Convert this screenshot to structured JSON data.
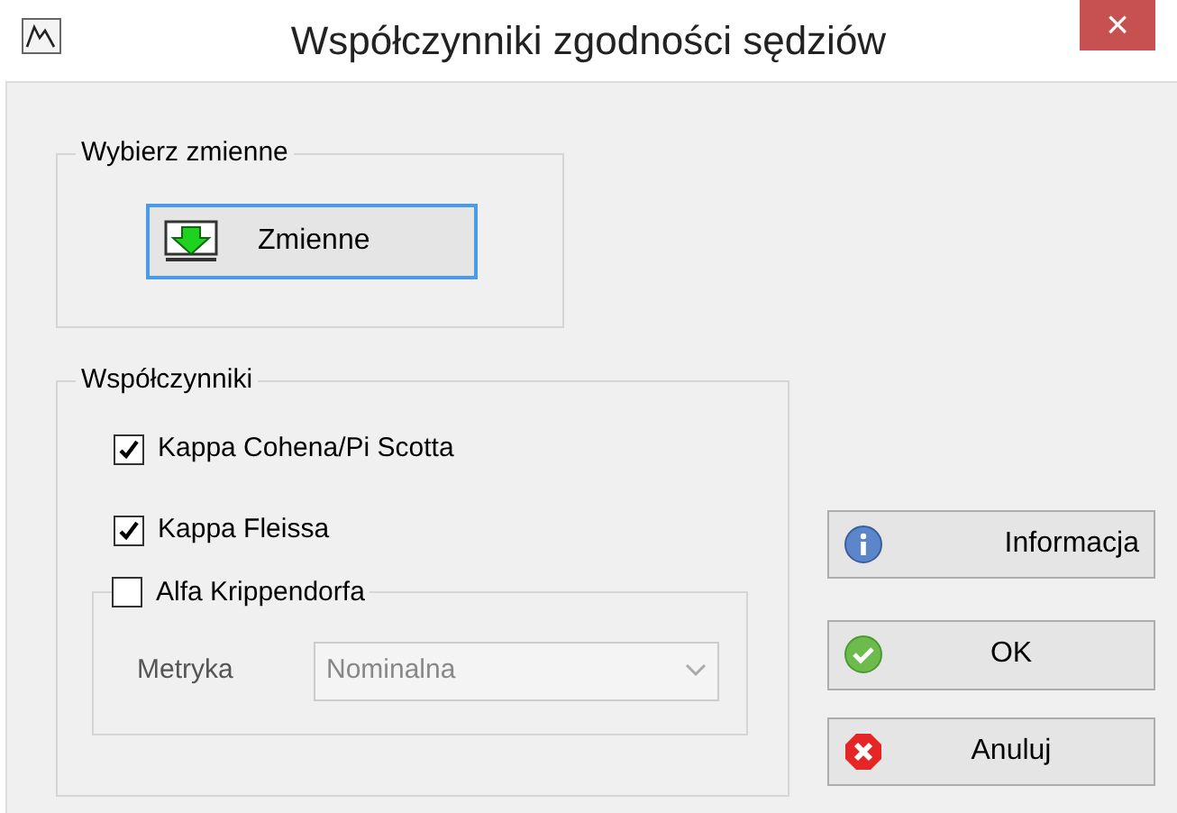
{
  "window": {
    "title": "Współczynniki zgodności sędziów",
    "close": "×"
  },
  "variables_group": {
    "legend": "Wybierz zmienne",
    "button": "Zmienne"
  },
  "coefficients_group": {
    "legend": "Współczynniki",
    "checkboxes": [
      {
        "label": "Kappa Cohena/Pi Scotta",
        "checked": true
      },
      {
        "label": "Kappa Fleissa",
        "checked": true
      }
    ],
    "krippendorff": {
      "label": "Alfa Krippendorfa",
      "checked": false,
      "metric_label": "Metryka",
      "metric": {
        "value": "Nominalna",
        "disabled": true
      }
    }
  },
  "buttons": [
    {
      "kind": "info",
      "label": "Informacja"
    },
    {
      "kind": "ok",
      "label": "OK"
    },
    {
      "kind": "cancel",
      "label": "Anuluj"
    }
  ]
}
